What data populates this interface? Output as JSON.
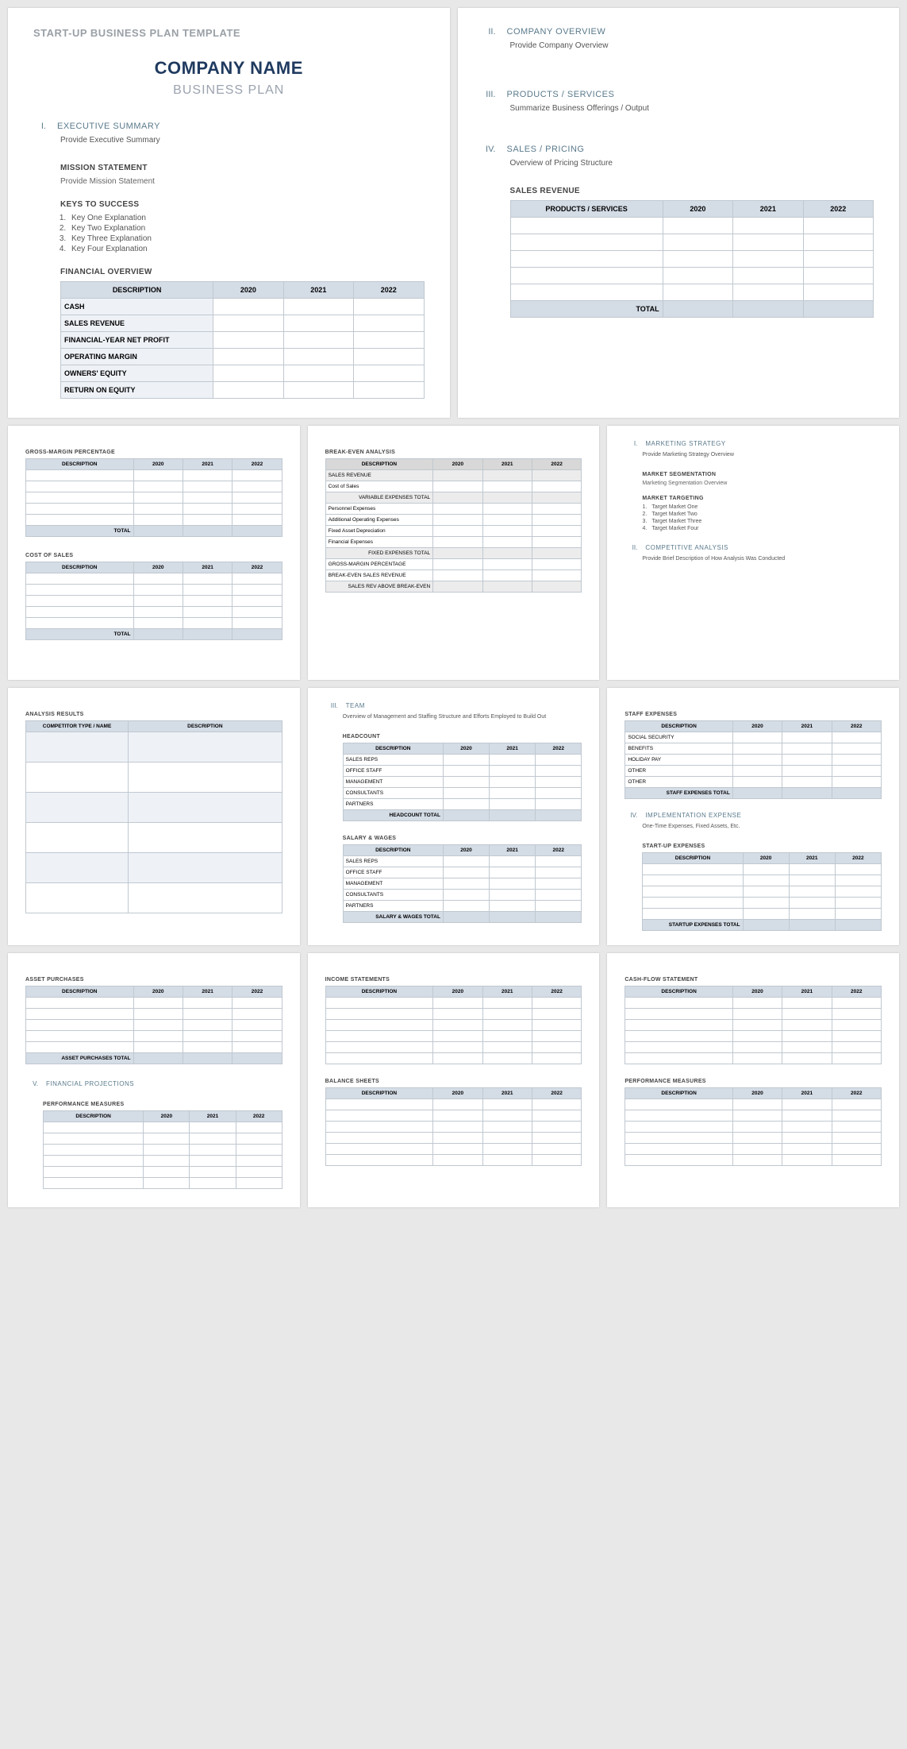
{
  "template_title": "START-UP BUSINESS PLAN TEMPLATE",
  "company_name": "COMPANY NAME",
  "subtitle": "BUSINESS PLAN",
  "years": {
    "y1": "2020",
    "y2": "2021",
    "y3": "2022"
  },
  "page1": {
    "exec": {
      "num": "I.",
      "title": "EXECUTIVE SUMMARY",
      "body": "Provide Executive Summary"
    },
    "mission": {
      "head": "MISSION STATEMENT",
      "body": "Provide Mission Statement"
    },
    "keys": {
      "head": "KEYS TO SUCCESS",
      "items": [
        "Key One Explanation",
        "Key Two Explanation",
        "Key Three Explanation",
        "Key Four Explanation"
      ]
    },
    "fin": {
      "head": "FINANCIAL OVERVIEW",
      "desc": "DESCRIPTION",
      "rows": [
        "CASH",
        "SALES REVENUE",
        "FINANCIAL-YEAR NET PROFIT",
        "OPERATING MARGIN",
        "OWNERS' EQUITY",
        "RETURN ON EQUITY"
      ]
    }
  },
  "page2": {
    "co": {
      "num": "II.",
      "title": "COMPANY OVERVIEW",
      "body": "Provide Company Overview"
    },
    "ps": {
      "num": "III.",
      "title": "PRODUCTS / SERVICES",
      "body": "Summarize Business Offerings / Output"
    },
    "sp": {
      "num": "IV.",
      "title": "SALES / PRICING",
      "body": "Overview of Pricing Structure"
    },
    "sr": {
      "head": "SALES REVENUE",
      "col1": "PRODUCTS / SERVICES",
      "total": "TOTAL"
    }
  },
  "page3": {
    "gmp": {
      "head": "GROSS-MARGIN PERCENTAGE",
      "desc": "DESCRIPTION",
      "total": "TOTAL"
    },
    "cos": {
      "head": "COST OF SALES",
      "desc": "DESCRIPTION",
      "total": "TOTAL"
    }
  },
  "page4": {
    "bea": {
      "head": "BREAK-EVEN ANALYSIS",
      "desc": "DESCRIPTION",
      "r1": "SALES REVENUE",
      "r2": "Cost of Sales",
      "vet": "VARIABLE EXPENSES TOTAL",
      "r3": "Personnel Expenses",
      "r4": "Additional Operating Expenses",
      "r5": "Fixed Asset Depreciation",
      "r6": "Financial Expenses",
      "fet": "FIXED EXPENSES TOTAL",
      "r7": "GROSS-MARGIN PERCENTAGE",
      "r8": "BREAK-EVEN SALES REVENUE",
      "above": "SALES REV ABOVE BREAK-EVEN"
    }
  },
  "page5": {
    "ms": {
      "num": "I.",
      "title": "MARKETING STRATEGY",
      "body": "Provide Marketing Strategy Overview"
    },
    "seg": {
      "head": "MARKET SEGMENTATION",
      "body": "Marketing Segmentation Overview"
    },
    "tgt": {
      "head": "MARKET TARGETING",
      "items": [
        "Target Market One",
        "Target Market Two",
        "Target Market Three",
        "Target Market Four"
      ]
    },
    "ca": {
      "num": "II.",
      "title": "COMPETITIVE ANALYSIS",
      "body": "Provide Brief Description of How Analysis Was Conducted"
    }
  },
  "page6": {
    "ar": {
      "head": "ANALYSIS RESULTS",
      "c1": "COMPETITOR TYPE / NAME",
      "c2": "DESCRIPTION"
    }
  },
  "page7": {
    "team": {
      "num": "III.",
      "title": "TEAM",
      "body": "Overview of Management and Staffing Structure and Efforts Employed to Build Out"
    },
    "hc": {
      "head": "HEADCOUNT",
      "desc": "DESCRIPTION",
      "rows": [
        "SALES REPS",
        "OFFICE STAFF",
        "MANAGEMENT",
        "CONSULTANTS",
        "PARTNERS"
      ],
      "total": "HEADCOUNT TOTAL"
    },
    "sw": {
      "head": "SALARY & WAGES",
      "desc": "DESCRIPTION",
      "rows": [
        "SALES REPS",
        "OFFICE STAFF",
        "MANAGEMENT",
        "CONSULTANTS",
        "PARTNERS"
      ],
      "total": "SALARY & WAGES TOTAL"
    }
  },
  "page8": {
    "se": {
      "head": "STAFF EXPENSES",
      "desc": "DESCRIPTION",
      "rows": [
        "SOCIAL SECURITY",
        "BENEFITS",
        "HOLIDAY PAY",
        "OTHER",
        "OTHER"
      ],
      "total": "STAFF EXPENSES TOTAL"
    },
    "ie": {
      "num": "IV.",
      "title": "IMPLEMENTATION EXPENSE",
      "body": "One-Time Expenses, Fixed Assets, Etc."
    },
    "su": {
      "head": "START-UP EXPENSES",
      "desc": "DESCRIPTION",
      "total": "STARTUP EXPENSES TOTAL"
    }
  },
  "page9": {
    "ap": {
      "head": "ASSET PURCHASES",
      "desc": "DESCRIPTION",
      "total": "ASSET PURCHASES TOTAL"
    },
    "fp": {
      "num": "V.",
      "title": "FINANCIAL PROJECTIONS"
    },
    "pm": {
      "head": "PERFORMANCE MEASURES",
      "desc": "DESCRIPTION"
    }
  },
  "page10": {
    "is": {
      "head": "INCOME STATEMENTS",
      "desc": "DESCRIPTION"
    },
    "bs": {
      "head": "BALANCE SHEETS",
      "desc": "DESCRIPTION"
    }
  },
  "page11": {
    "cf": {
      "head": "CASH-FLOW STATEMENT",
      "desc": "DESCRIPTION"
    },
    "pm": {
      "head": "PERFORMANCE MEASURES",
      "desc": "DESCRIPTION"
    }
  }
}
